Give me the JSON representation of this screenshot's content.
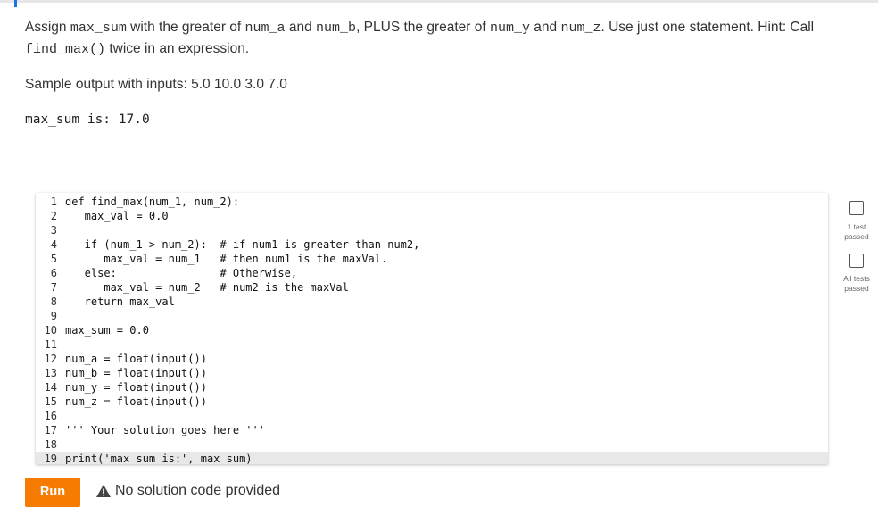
{
  "prompt": {
    "parts": [
      {
        "t": "Assign ",
        "code": false
      },
      {
        "t": "max_sum",
        "code": true
      },
      {
        "t": " with the greater of ",
        "code": false
      },
      {
        "t": "num_a",
        "code": true
      },
      {
        "t": " and ",
        "code": false
      },
      {
        "t": "num_b",
        "code": true
      },
      {
        "t": ", PLUS the greater of ",
        "code": false
      },
      {
        "t": "num_y",
        "code": true
      },
      {
        "t": " and ",
        "code": false
      },
      {
        "t": "num_z",
        "code": true
      },
      {
        "t": ". Use just one statement. Hint: Call ",
        "code": false
      },
      {
        "t": "find_max()",
        "code": true
      },
      {
        "t": " twice in an expression.",
        "code": false
      }
    ]
  },
  "sample": {
    "label": "Sample output with inputs: 5.0 10.0 3.0 7.0",
    "output": "max_sum is: 17.0"
  },
  "editor": {
    "lines": [
      {
        "n": "1",
        "text": "def find_max(num_1, num_2):"
      },
      {
        "n": "2",
        "text": "   max_val = 0.0"
      },
      {
        "n": "3",
        "text": ""
      },
      {
        "n": "4",
        "text": "   if (num_1 > num_2):  # if num1 is greater than num2,"
      },
      {
        "n": "5",
        "text": "      max_val = num_1   # then num1 is the maxVal."
      },
      {
        "n": "6",
        "text": "   else:                # Otherwise,"
      },
      {
        "n": "7",
        "text": "      max_val = num_2   # num2 is the maxVal"
      },
      {
        "n": "8",
        "text": "   return max_val"
      },
      {
        "n": "9",
        "text": ""
      },
      {
        "n": "10",
        "text": "max_sum = 0.0"
      },
      {
        "n": "11",
        "text": ""
      },
      {
        "n": "12",
        "text": "num_a = float(input())"
      },
      {
        "n": "13",
        "text": "num_b = float(input())"
      },
      {
        "n": "14",
        "text": "num_y = float(input())"
      },
      {
        "n": "15",
        "text": "num_z = float(input())"
      },
      {
        "n": "16",
        "text": ""
      },
      {
        "n": "17",
        "text": "''' Your solution goes here '''"
      },
      {
        "n": "18",
        "text": ""
      },
      {
        "n": "19",
        "text": "print('max_sum is:', max_sum)"
      }
    ],
    "active_line": 19
  },
  "status": {
    "test1_label": "1 test passed",
    "all_label": "All tests passed"
  },
  "footer": {
    "run_label": "Run",
    "message": "No solution code provided"
  },
  "colors": {
    "accent": "#f57c00",
    "topbar_accent": "#1a73e8"
  }
}
